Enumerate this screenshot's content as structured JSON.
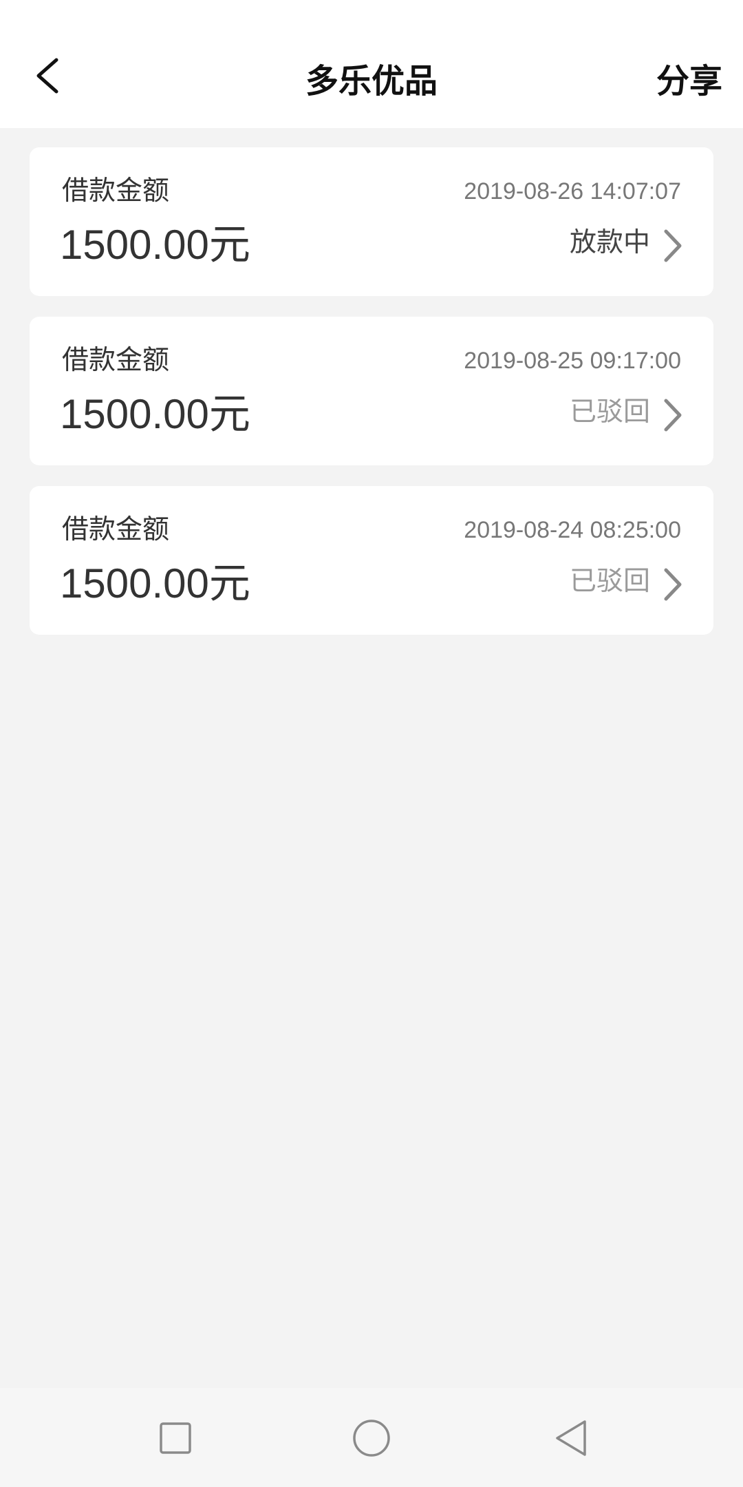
{
  "header": {
    "title": "多乐优品",
    "share_label": "分享",
    "back_icon": "chevron-left-icon"
  },
  "loans": [
    {
      "label": "借款金额",
      "amount": "1500.00元",
      "datetime": "2019-08-26 14:07:07",
      "status": "放款中",
      "status_color": "#444444"
    },
    {
      "label": "借款金额",
      "amount": "1500.00元",
      "datetime": "2019-08-25 09:17:00",
      "status": "已驳回",
      "status_color": "#9a9a9a"
    },
    {
      "label": "借款金额",
      "amount": "1500.00元",
      "datetime": "2019-08-24 08:25:00",
      "status": "已驳回",
      "status_color": "#9a9a9a"
    }
  ],
  "navbar": {
    "recent_icon": "square-recent-apps-icon",
    "home_icon": "circle-home-icon",
    "back_icon": "triangle-back-icon"
  },
  "colors": {
    "background": "#f3f3f3",
    "card": "#ffffff",
    "text_primary": "#333333",
    "text_secondary": "#777777"
  }
}
